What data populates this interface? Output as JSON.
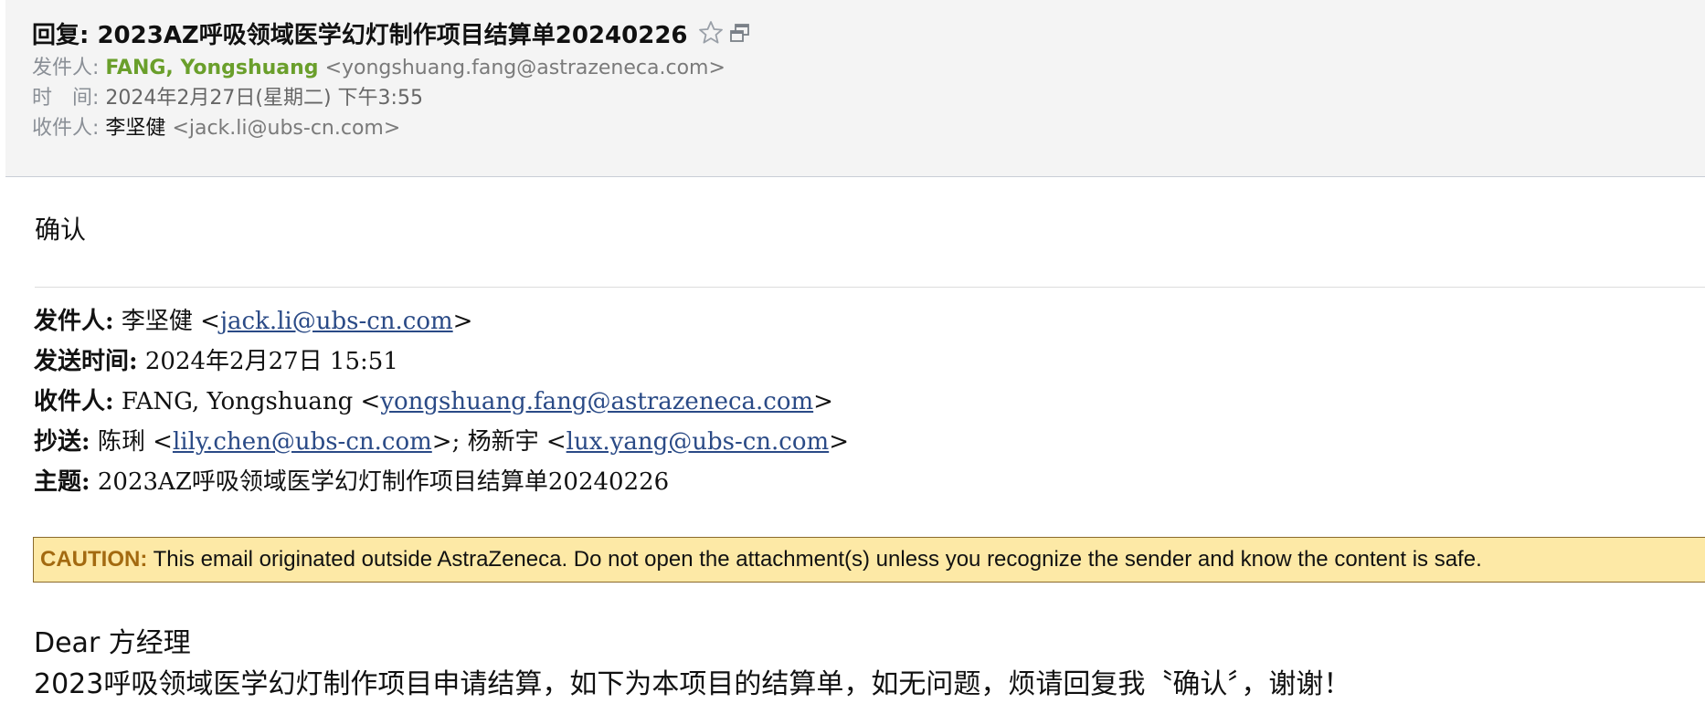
{
  "header": {
    "subject": "回复: 2023AZ呼吸领域医学幻灯制作项目结算单20240226",
    "icons": {
      "star": "star-icon",
      "new_window": "new-window-icon"
    },
    "from": {
      "label": "发件人:",
      "name": "FANG, Yongshuang",
      "email": "<yongshuang.fang@astrazeneca.com>"
    },
    "time": {
      "label": "时　间:",
      "value": "2024年2月27日(星期二) 下午3:55"
    },
    "to": {
      "label": "收件人:",
      "name": "李坚健",
      "email": "<jack.li@ubs-cn.com>"
    }
  },
  "body": {
    "reply_text": "确认",
    "quoted": {
      "from_label": "发件人:",
      "from_name": " 李坚健 <",
      "from_email": "jack.li@ubs-cn.com",
      "from_end": ">",
      "sent_label": "发送时间:",
      "sent_value": " 2024年2月27日 15:51",
      "to_label": "收件人:",
      "to_name": " FANG, Yongshuang <",
      "to_email": "yongshuang.fang@astrazeneca.com",
      "to_end": ">",
      "cc_label": "抄送:",
      "cc_name1": " 陈琍 <",
      "cc_email1": "lily.chen@ubs-cn.com",
      "cc_sep": ">; 杨新宇 <",
      "cc_email2": "lux.yang@ubs-cn.com",
      "cc_end": ">",
      "subject_label": "主题:",
      "subject_value": " 2023AZ呼吸领域医学幻灯制作项目结算单20240226"
    },
    "caution": {
      "label": "CAUTION:",
      "text": " This email originated outside AstraZeneca. Do not open the attachment(s) unless you recognize the sender and know the content is safe."
    },
    "greeting": "Dear 方经理",
    "body_line": "2023呼吸领域医学幻灯制作项目申请结算，如下为本项目的结算单，如无问题，烦请回复我〝确认〞，谢谢！"
  },
  "colors": {
    "header_bg": "#f4f4f4",
    "sender_name": "#6a9f2b",
    "link": "#2a4a86",
    "caution_bg": "#fde9a6",
    "caution_label": "#a36a10"
  }
}
